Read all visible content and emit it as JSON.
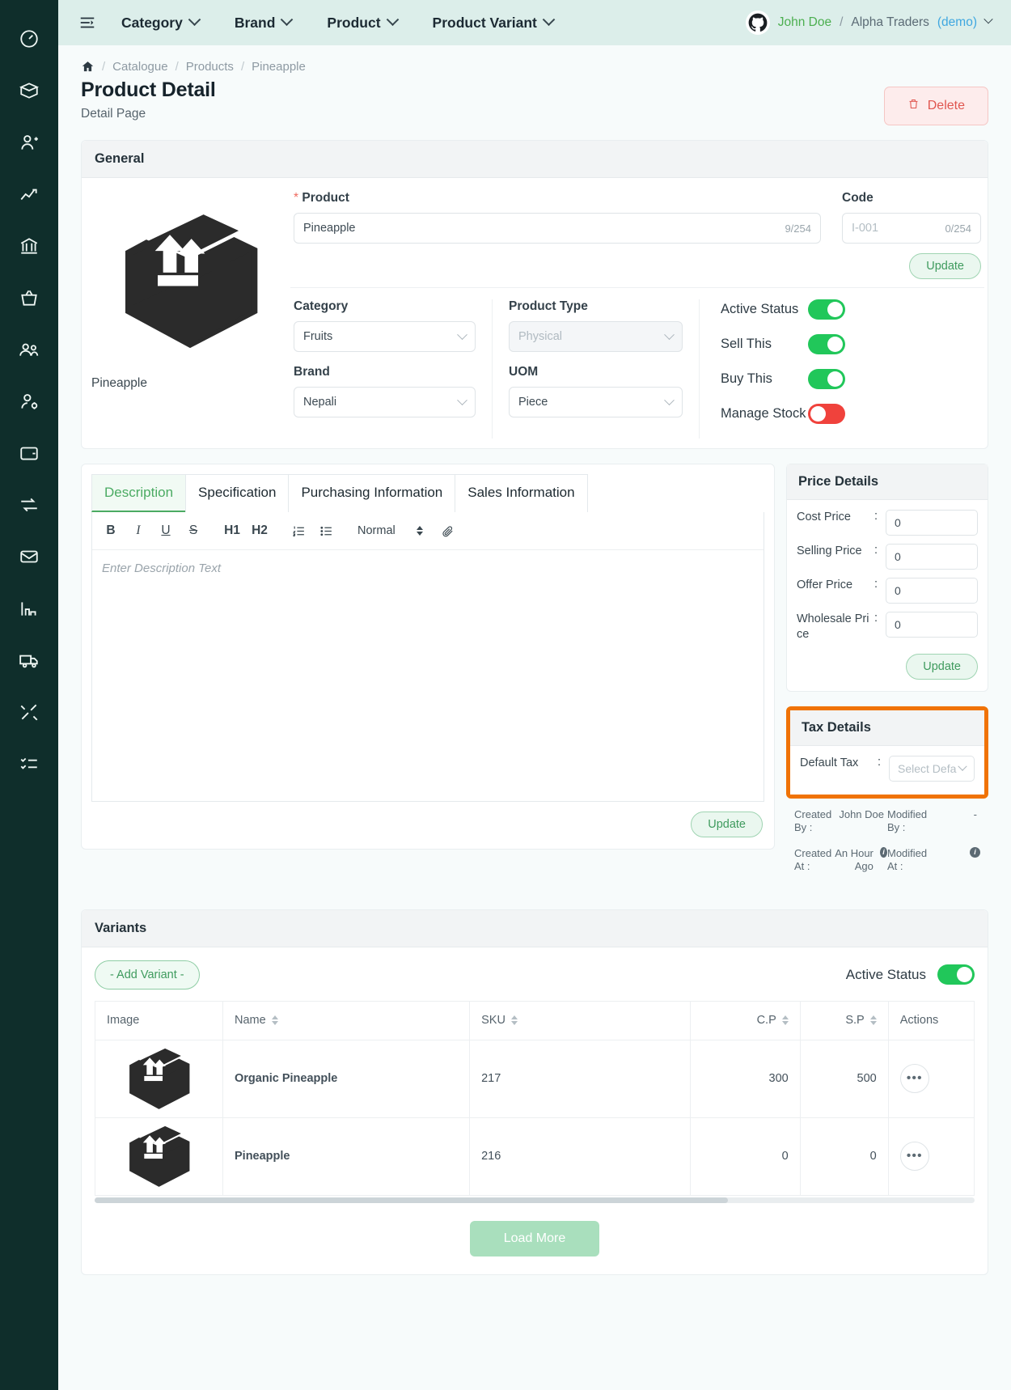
{
  "sidebar": {
    "items": [
      {
        "name": "dashboard",
        "icon": "speedometer-icon"
      },
      {
        "name": "catalogue",
        "icon": "box-open-icon"
      },
      {
        "name": "customers",
        "icon": "user-plus-icon"
      },
      {
        "name": "reports",
        "icon": "chart-line-icon"
      },
      {
        "name": "store",
        "icon": "bank-icon"
      },
      {
        "name": "purchase",
        "icon": "shopping-basket-icon"
      },
      {
        "name": "contacts",
        "icon": "users-icon"
      },
      {
        "name": "staff",
        "icon": "user-settings-icon"
      },
      {
        "name": "payments",
        "icon": "wallet-icon"
      },
      {
        "name": "expenses",
        "icon": "money-transfer-icon"
      },
      {
        "name": "inbox",
        "icon": "envelope-icon"
      },
      {
        "name": "analytics",
        "icon": "bar-chart-icon"
      },
      {
        "name": "delivery",
        "icon": "truck-icon"
      },
      {
        "name": "tools",
        "icon": "tools-icon"
      },
      {
        "name": "tasks",
        "icon": "checklist-icon"
      }
    ]
  },
  "topbar": {
    "menu_icon": "hamburger-collapse-icon",
    "nav": [
      {
        "label": "Category"
      },
      {
        "label": "Brand"
      },
      {
        "label": "Product"
      },
      {
        "label": "Product Variant"
      }
    ],
    "user": {
      "avatar_icon": "github-avatar-icon",
      "name": "John Doe",
      "separator": "/",
      "org": "Alpha Traders",
      "demo": "(demo)"
    }
  },
  "breadcrumb": {
    "home_icon": "home-icon",
    "items": [
      "Catalogue",
      "Products",
      "Pineapple"
    ],
    "separator": "/"
  },
  "page": {
    "title": "Product Detail",
    "subtitle": "Detail Page",
    "delete_label": "Delete",
    "delete_icon": "trash-icon"
  },
  "general": {
    "heading": "General",
    "thumbnail_icon": "package-box-icon",
    "thumbnail_caption": "Pineapple",
    "product_label": "Product",
    "product_required": "*",
    "product_value": "Pineapple",
    "product_counter": "9/254",
    "code_label": "Code",
    "code_placeholder": "I-001",
    "code_counter": "0/254",
    "update_label": "Update",
    "category_label": "Category",
    "category_value": "Fruits",
    "brand_label": "Brand",
    "brand_value": "Nepali",
    "product_type_label": "Product Type",
    "product_type_value": "Physical",
    "uom_label": "UOM",
    "uom_value": "Piece",
    "toggles": [
      {
        "label": "Active Status",
        "state": "on"
      },
      {
        "label": "Sell This",
        "state": "on"
      },
      {
        "label": "Buy This",
        "state": "on"
      },
      {
        "label": "Manage Stock",
        "state": "off"
      }
    ]
  },
  "tabs": [
    {
      "label": "Description",
      "active": true
    },
    {
      "label": "Specification",
      "active": false
    },
    {
      "label": "Purchasing Information",
      "active": false
    },
    {
      "label": "Sales Information",
      "active": false
    }
  ],
  "editor": {
    "tools": [
      {
        "name": "bold",
        "glyph": "B"
      },
      {
        "name": "italic",
        "glyph": "I"
      },
      {
        "name": "underline",
        "glyph": "U"
      },
      {
        "name": "strikethrough",
        "glyph": "S"
      },
      {
        "name": "heading-1",
        "glyph": "H1"
      },
      {
        "name": "heading-2",
        "glyph": "H2"
      },
      {
        "name": "ordered-list",
        "glyph": "list-ol-icon"
      },
      {
        "name": "bullet-list",
        "glyph": "list-ul-icon"
      }
    ],
    "format_value": "Normal",
    "attach_icon": "paperclip-icon",
    "placeholder": "Enter Description Text",
    "update_label": "Update"
  },
  "price_details": {
    "heading": "Price Details",
    "rows": [
      {
        "label": "Cost Price",
        "value": "0"
      },
      {
        "label": "Selling Price",
        "value": "0"
      },
      {
        "label": "Offer Price",
        "value": "0"
      },
      {
        "label": "Wholesale Price",
        "value": "0"
      }
    ],
    "colon": ":",
    "update_label": "Update"
  },
  "tax_details": {
    "heading": "Tax Details",
    "label": "Default Tax",
    "colon": ":",
    "placeholder": "Select Defa",
    "highlight_color": "#f07306"
  },
  "meta": {
    "created_by_label": "Created By :",
    "created_by_value": "John Doe",
    "created_at_label": "Created At :",
    "created_at_value": "An Hour Ago",
    "modified_by_label": "Modified By :",
    "modified_by_value": "-",
    "modified_at_label": "Modified At :",
    "modified_at_value": "",
    "info_icon": "info-icon"
  },
  "variants": {
    "heading": "Variants",
    "add_label": "- Add Variant -",
    "active_status_label": "Active Status",
    "active_status_state": "on",
    "columns": [
      "Image",
      "Name",
      "SKU",
      "C.P",
      "S.P",
      "Actions"
    ],
    "rows": [
      {
        "image_icon": "package-box-icon",
        "name": "Organic Pineapple",
        "sku": "217",
        "cp": "300",
        "sp": "500",
        "action_icon": "more-dots-icon"
      },
      {
        "image_icon": "package-box-icon",
        "name": "Pineapple",
        "sku": "216",
        "cp": "0",
        "sp": "0",
        "action_icon": "more-dots-icon"
      }
    ],
    "load_more_label": "Load More"
  },
  "colors": {
    "sidebar": "#0f2e2b",
    "topbar": "#dceeea",
    "accent_green": "#3f9b5e",
    "toggle_on": "#21c75a",
    "toggle_off": "#f0423c",
    "danger": "#e0564f",
    "highlight_orange": "#f07306"
  }
}
